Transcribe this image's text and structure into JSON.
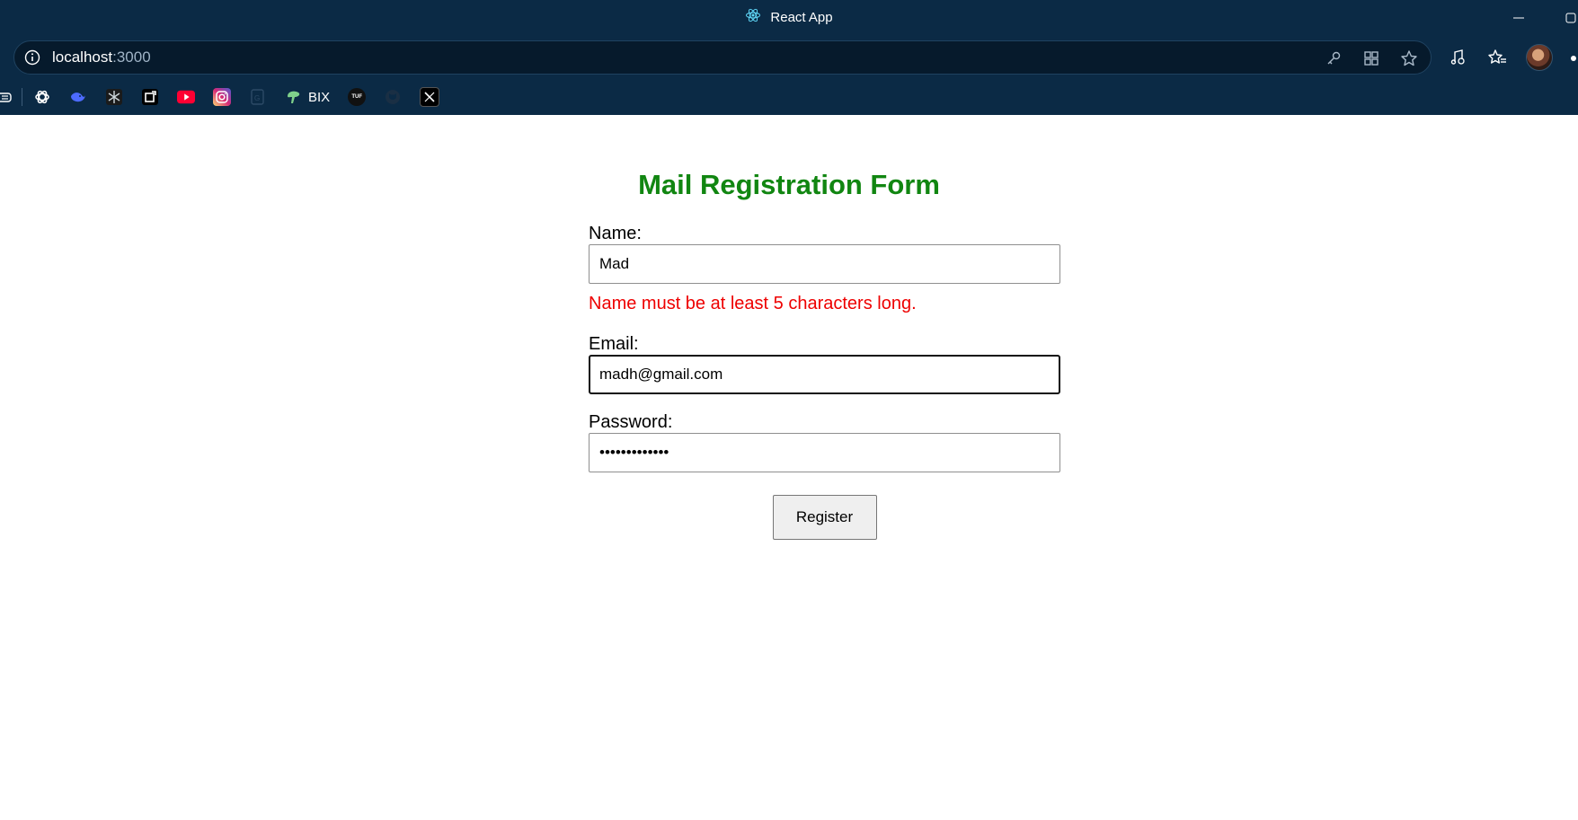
{
  "browser": {
    "window_title": "React App",
    "url_host": "localhost",
    "url_port": ":3000",
    "bookmarks": [
      {
        "icon": "openai-icon"
      },
      {
        "icon": "deepseek-icon"
      },
      {
        "icon": "perplexity-icon"
      },
      {
        "icon": "capcut-icon"
      },
      {
        "icon": "youtube-icon"
      },
      {
        "icon": "instagram-icon"
      },
      {
        "icon": "doc-icon"
      },
      {
        "icon": "bix-icon",
        "label": "BIX"
      },
      {
        "icon": "tuf-icon",
        "label": "TUF"
      },
      {
        "icon": "github-icon"
      },
      {
        "icon": "x-icon"
      }
    ]
  },
  "form": {
    "title": "Mail Registration Form",
    "name_label": "Name:",
    "name_value": "Mad",
    "name_error": "Name must be at least 5 characters long.",
    "email_label": "Email:",
    "email_value": "madh@gmail.com",
    "password_label": "Password:",
    "password_value": "•••••••••••••",
    "submit_label": "Register"
  },
  "colors": {
    "title": "#118611",
    "error": "#ee0000",
    "browser_frame": "#0b2a45"
  }
}
